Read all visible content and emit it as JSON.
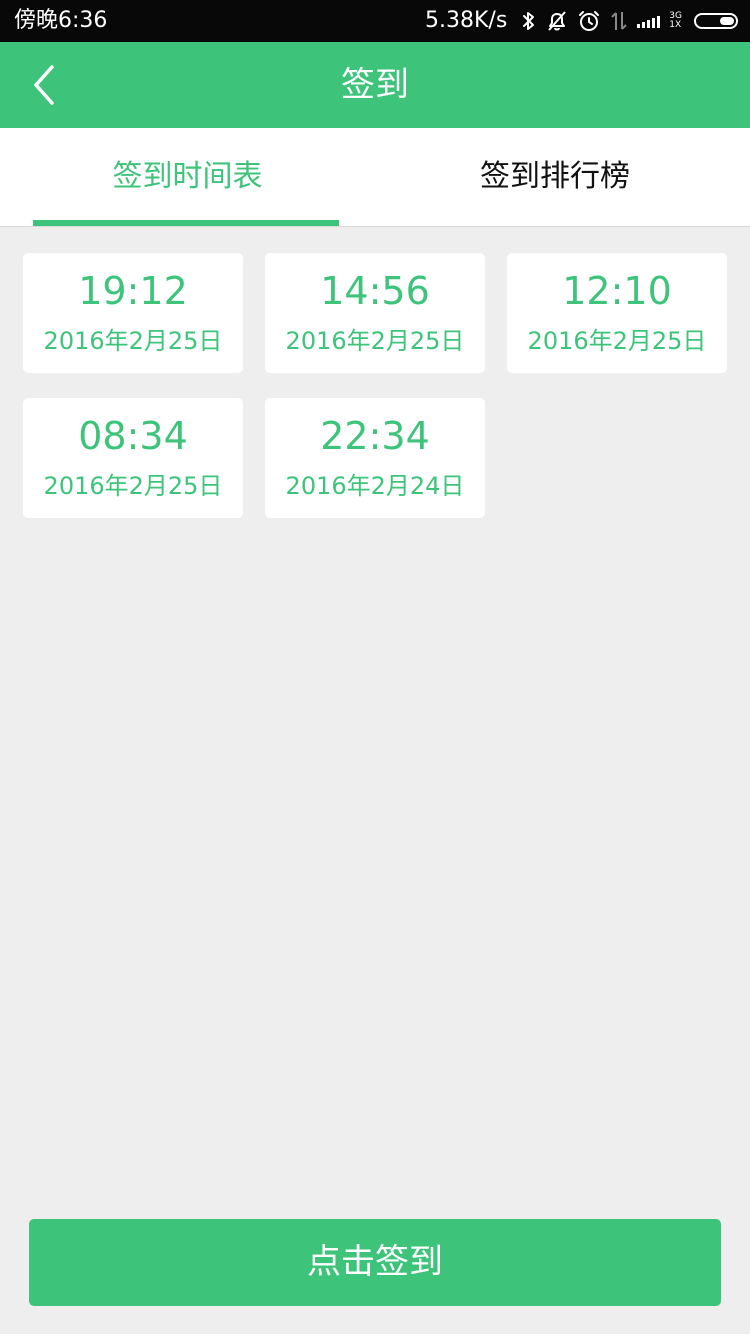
{
  "status_bar": {
    "time": "傍晚6:36",
    "net_speed": "5.38K/s",
    "network_top": "3G",
    "network_bottom": "1X",
    "icons": [
      "bluetooth-icon",
      "bell-off-icon",
      "alarm-icon",
      "data-transfer-icon",
      "signal-icon",
      "battery-icon"
    ]
  },
  "nav": {
    "title": "签到",
    "back_icon": "chevron-left-icon"
  },
  "tabs": [
    {
      "label": "签到时间表",
      "active": true
    },
    {
      "label": "签到排行榜",
      "active": false
    }
  ],
  "records": [
    {
      "time": "19:12",
      "date": "2016年2月25日"
    },
    {
      "time": "14:56",
      "date": "2016年2月25日"
    },
    {
      "time": "12:10",
      "date": "2016年2月25日"
    },
    {
      "time": "08:34",
      "date": "2016年2月25日"
    },
    {
      "time": "22:34",
      "date": "2016年2月24日"
    }
  ],
  "checkin_button": {
    "label": "点击签到"
  },
  "colors": {
    "accent": "#3ec47a",
    "background": "#eeeeee",
    "status_bar": "#080808"
  }
}
